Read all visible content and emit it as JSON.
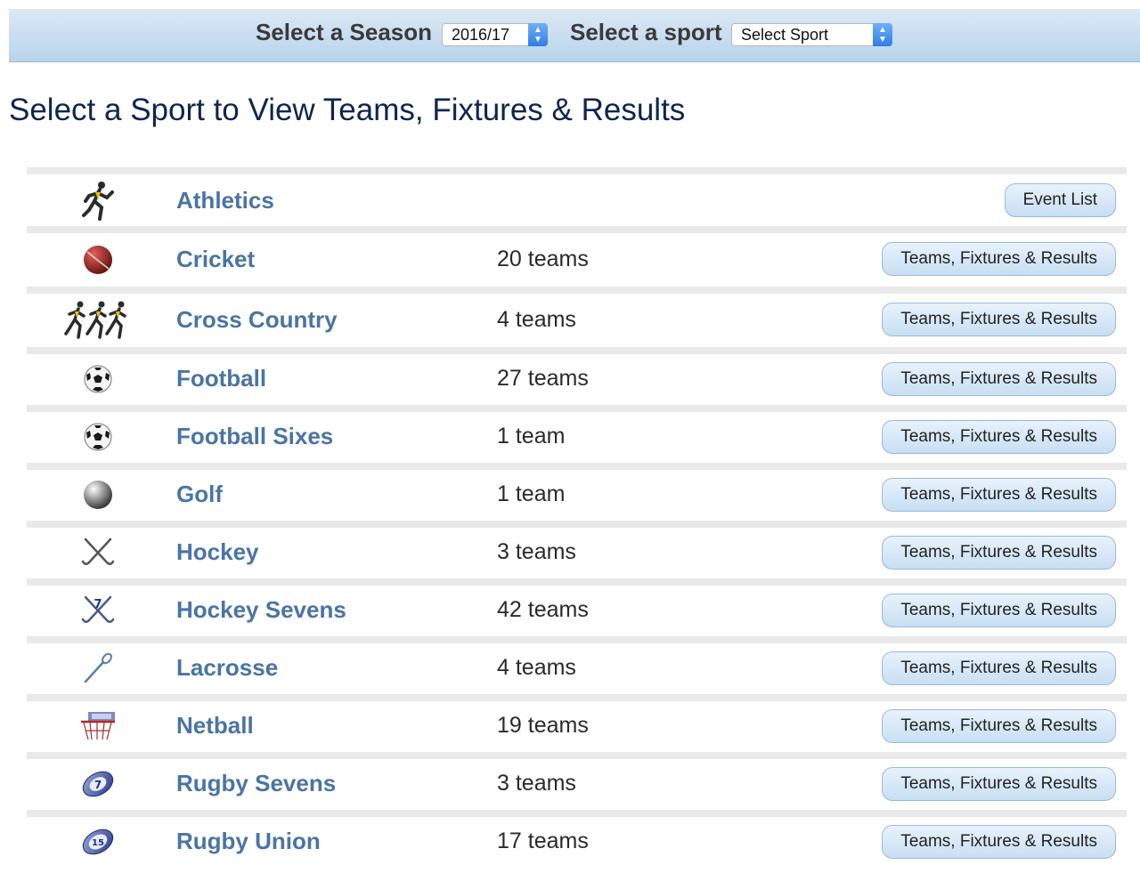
{
  "topbar": {
    "season_label": "Select a Season",
    "season_value": "2016/17",
    "sport_label": "Select a sport",
    "sport_value": "Select Sport"
  },
  "heading": "Select a Sport to View Teams, Fixtures & Results",
  "sports": [
    {
      "name": "Athletics",
      "count": "",
      "button": "Event List",
      "icon": "runner-icon"
    },
    {
      "name": "Cricket",
      "count": "20 teams",
      "button": "Teams, Fixtures & Results",
      "icon": "cricket-ball-icon"
    },
    {
      "name": "Cross Country",
      "count": "4 teams",
      "button": "Teams, Fixtures & Results",
      "icon": "runners-group-icon"
    },
    {
      "name": "Football",
      "count": "27 teams",
      "button": "Teams, Fixtures & Results",
      "icon": "football-icon"
    },
    {
      "name": "Football Sixes",
      "count": "1 team",
      "button": "Teams, Fixtures & Results",
      "icon": "football-icon"
    },
    {
      "name": "Golf",
      "count": "1 team",
      "button": "Teams, Fixtures & Results",
      "icon": "golf-ball-icon"
    },
    {
      "name": "Hockey",
      "count": "3 teams",
      "button": "Teams, Fixtures & Results",
      "icon": "hockey-sticks-icon"
    },
    {
      "name": "Hockey Sevens",
      "count": "42 teams",
      "button": "Teams, Fixtures & Results",
      "icon": "hockey-sevens-icon"
    },
    {
      "name": "Lacrosse",
      "count": "4 teams",
      "button": "Teams, Fixtures & Results",
      "icon": "lacrosse-stick-icon"
    },
    {
      "name": "Netball",
      "count": "19 teams",
      "button": "Teams, Fixtures & Results",
      "icon": "netball-hoop-icon"
    },
    {
      "name": "Rugby Sevens",
      "count": "3 teams",
      "button": "Teams, Fixtures & Results",
      "icon": "rugby-sevens-ball-icon"
    },
    {
      "name": "Rugby Union",
      "count": "17 teams",
      "button": "Teams, Fixtures & Results",
      "icon": "rugby-union-ball-icon"
    }
  ],
  "colors": {
    "sport_name": "#4a74a4",
    "heading": "#0d2550",
    "topbar": "#c8ddef"
  }
}
